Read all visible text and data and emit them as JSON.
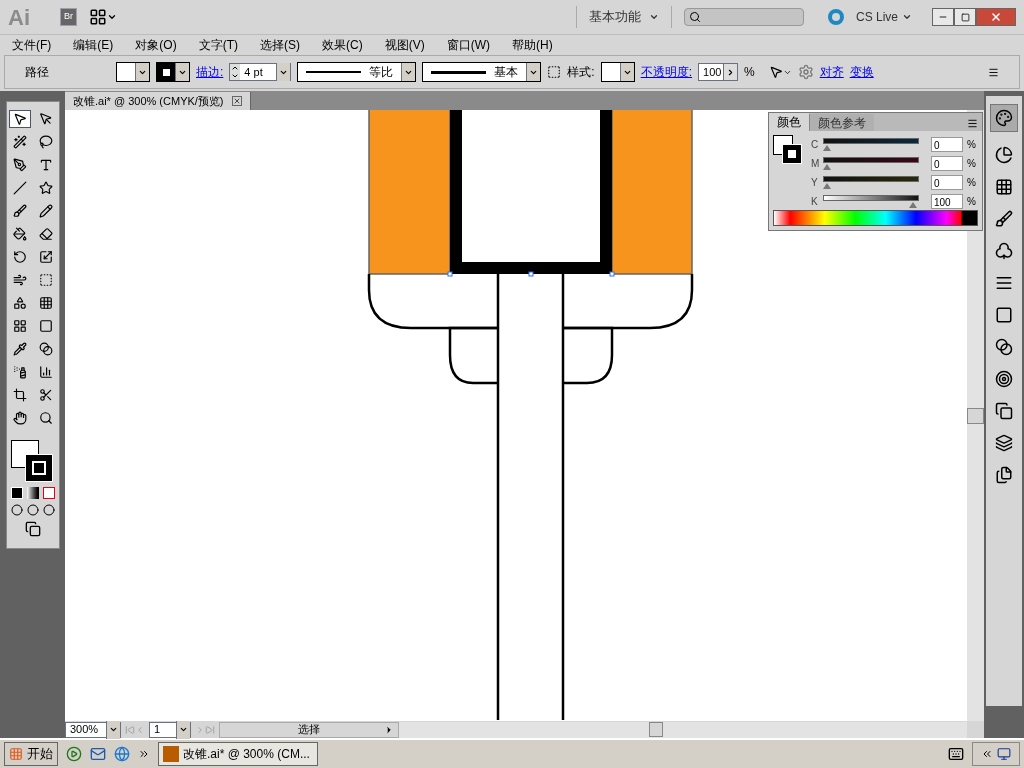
{
  "window": {
    "app_logo": "Ai",
    "bridge": "Br",
    "workspace": "基本功能",
    "cs_live": "CS Live"
  },
  "menu": [
    "文件(F)",
    "编辑(E)",
    "对象(O)",
    "文字(T)",
    "选择(S)",
    "效果(C)",
    "视图(V)",
    "窗口(W)",
    "帮助(H)"
  ],
  "control_bar": {
    "object_type": "路径",
    "stroke_link": "描边:",
    "stroke_weight": "4 pt",
    "profile": "等比",
    "brush": "基本",
    "style_label": "样式:",
    "opacity_link": "不透明度:",
    "opacity": "100",
    "percent": "%",
    "align_link": "对齐",
    "transform_link": "变换"
  },
  "document_tab": {
    "title": "改锥.ai* @ 300% (CMYK/预览)"
  },
  "tools": [
    {
      "kind": "select",
      "selected": true
    },
    {
      "kind": "direct",
      "selected": false
    },
    {
      "kind": "wand",
      "selected": false
    },
    {
      "kind": "lasso",
      "selected": false
    },
    {
      "kind": "pen",
      "selected": false
    },
    {
      "kind": "type",
      "selected": false
    },
    {
      "kind": "line",
      "selected": false
    },
    {
      "kind": "star",
      "selected": false
    },
    {
      "kind": "brush",
      "selected": false
    },
    {
      "kind": "pencil",
      "selected": false
    },
    {
      "kind": "blob",
      "selected": false
    },
    {
      "kind": "eraser",
      "selected": false
    },
    {
      "kind": "rotate",
      "selected": false
    },
    {
      "kind": "scale",
      "selected": false
    },
    {
      "kind": "warp",
      "selected": false
    },
    {
      "kind": "free",
      "selected": false
    },
    {
      "kind": "shape",
      "selected": false
    },
    {
      "kind": "grid",
      "selected": false
    },
    {
      "kind": "mesh",
      "selected": false
    },
    {
      "kind": "gradient",
      "selected": false
    },
    {
      "kind": "eyedropper",
      "selected": false
    },
    {
      "kind": "blend",
      "selected": false
    },
    {
      "kind": "spray",
      "selected": false
    },
    {
      "kind": "chart",
      "selected": false
    },
    {
      "kind": "artboard",
      "selected": false
    },
    {
      "kind": "slice",
      "selected": false
    },
    {
      "kind": "hand",
      "selected": false
    },
    {
      "kind": "zoom",
      "selected": false
    }
  ],
  "color_panel": {
    "tabs": [
      {
        "label": "颜色",
        "selected": true
      },
      {
        "label": "颜色参考",
        "selected": false
      }
    ],
    "channels": [
      {
        "name": "C",
        "value": "0",
        "unit": "%",
        "level": 0
      },
      {
        "name": "M",
        "value": "0",
        "unit": "%",
        "level": 0
      },
      {
        "name": "Y",
        "value": "0",
        "unit": "%",
        "level": 0
      },
      {
        "name": "K",
        "value": "100",
        "unit": "%",
        "level": 1
      }
    ]
  },
  "status_bar": {
    "zoom": "300%",
    "page": "1",
    "status": "选择"
  },
  "taskbar": {
    "start": "开始",
    "task": "改锥.ai* @ 300% (CM..."
  }
}
